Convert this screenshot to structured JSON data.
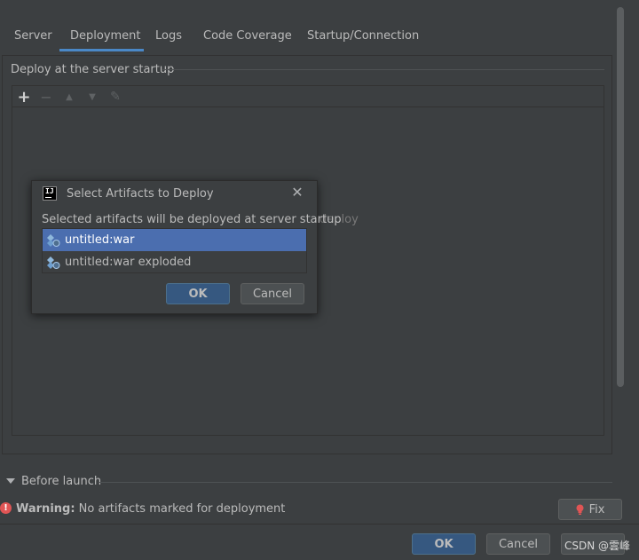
{
  "tabs": [
    "Server",
    "Deployment",
    "Logs",
    "Code Coverage",
    "Startup/Connection"
  ],
  "deploy_group": {
    "title": "Deploy at the server startup",
    "empty_hint": "deploy"
  },
  "toolbar": {
    "add": "+",
    "remove": "−",
    "up": "▲",
    "down": "▼",
    "edit": "✎"
  },
  "before_launch": {
    "label": "Before launch"
  },
  "warning": {
    "prefix": "Warning:",
    "message": "No artifacts marked for deployment",
    "fix_label": "Fix"
  },
  "footer": {
    "ok_label": "OK",
    "cancel_label": "Cancel",
    "watermark": "CSDN @雲峰"
  },
  "dialog": {
    "title": "Select Artifacts to Deploy",
    "logo_text": "IJ",
    "description": "Selected artifacts will be deployed at server startup",
    "artifacts": [
      {
        "label": "untitled:war",
        "selected": true
      },
      {
        "label": "untitled:war exploded",
        "selected": false
      }
    ],
    "ok_label": "OK",
    "cancel_label": "Cancel"
  },
  "colors": {
    "background": "#3c3f41",
    "accent": "#4a88c7",
    "selection": "#4b6eaf",
    "primary_button": "#365880",
    "error": "#e05555"
  }
}
